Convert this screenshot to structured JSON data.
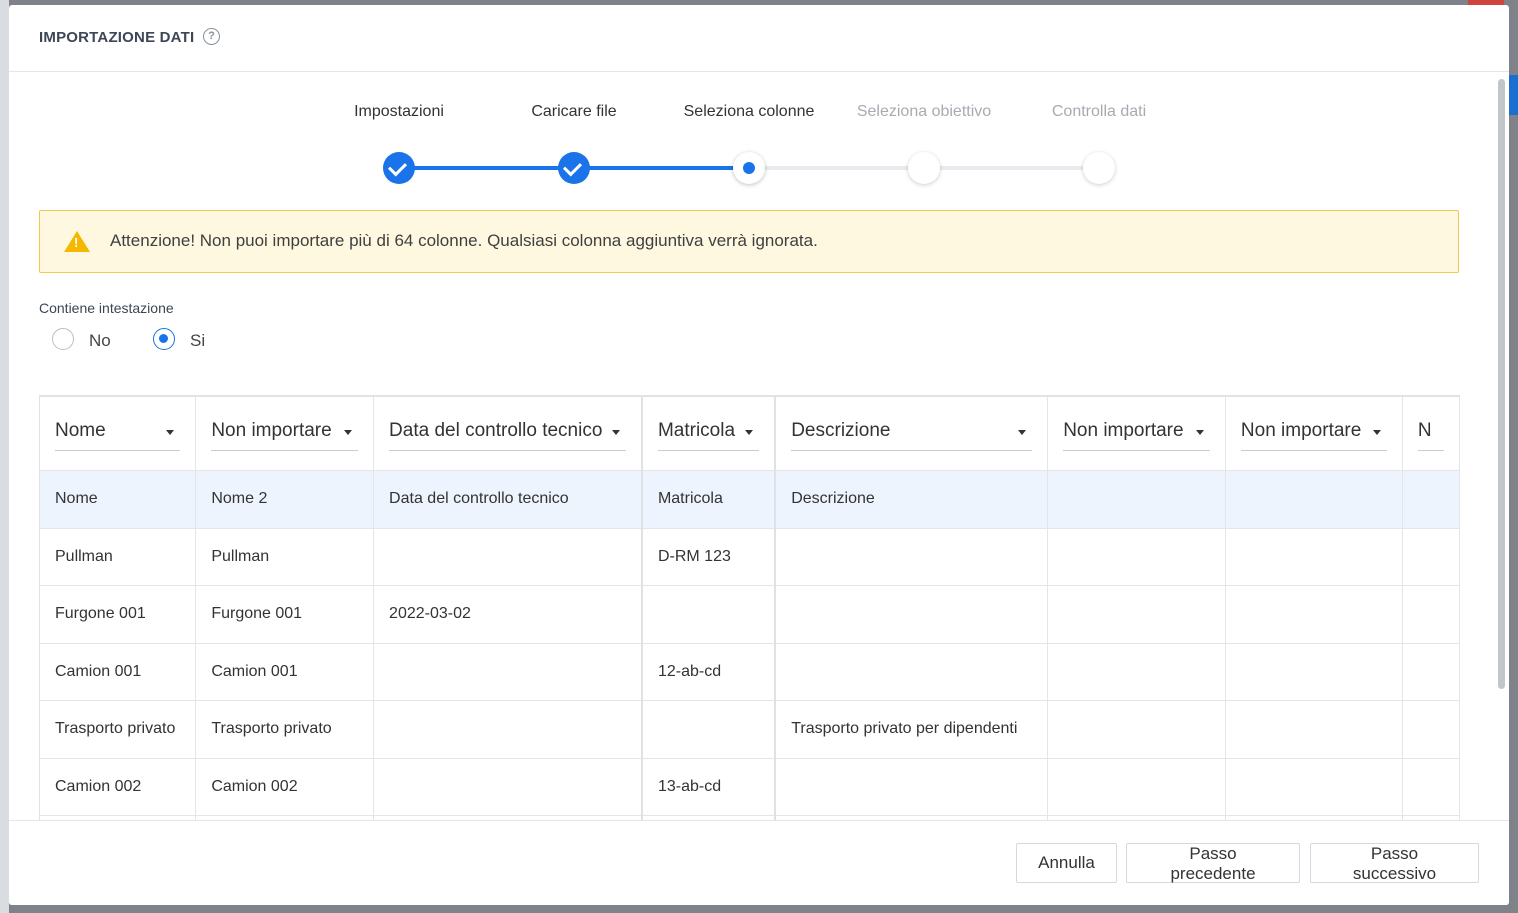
{
  "modal": {
    "title": "IMPORTAZIONE DATI",
    "help_icon": "?"
  },
  "stepper": {
    "steps": [
      {
        "label": "Impostazioni",
        "state": "done"
      },
      {
        "label": "Caricare file",
        "state": "done"
      },
      {
        "label": "Seleziona colonne",
        "state": "current"
      },
      {
        "label": "Seleziona obiettivo",
        "state": "todo"
      },
      {
        "label": "Controlla dati",
        "state": "todo"
      }
    ]
  },
  "warning": {
    "icon": "warning-triangle-icon",
    "icon_glyph": "!",
    "text": "Attenzione! Non puoi importare più di 64 colonne. Qualsiasi colonna aggiuntiva verrà ignorata."
  },
  "header_option": {
    "label": "Contiene intestazione",
    "options": [
      {
        "label": "No",
        "selected": false
      },
      {
        "label": "Si",
        "selected": true
      }
    ]
  },
  "table": {
    "column_selects": [
      "Nome",
      "Non importare",
      "Data del controllo tecnico",
      "Matricola",
      "Descrizione",
      "Non importare",
      "Non importare",
      "N"
    ],
    "rows": [
      [
        "Nome",
        "Nome 2",
        "Data del controllo tecnico",
        "Matricola",
        "Descrizione",
        "",
        "",
        ""
      ],
      [
        "Pullman",
        "Pullman",
        "",
        "D-RM 123",
        "",
        "",
        "",
        ""
      ],
      [
        "Furgone 001",
        "Furgone 001",
        "2022-03-02",
        "",
        "",
        "",
        "",
        ""
      ],
      [
        "Camion 001",
        "Camion 001",
        "",
        "12-ab-cd",
        "",
        "",
        "",
        ""
      ],
      [
        "Trasporto privato",
        "Trasporto privato",
        "",
        "",
        "Trasporto privato per dipendenti",
        "",
        "",
        ""
      ],
      [
        "Camion 002",
        "Camion 002",
        "",
        "13-ab-cd",
        "",
        "",
        "",
        ""
      ],
      [
        "",
        "",
        "",
        "",
        "",
        "",
        "",
        ""
      ]
    ]
  },
  "footer": {
    "cancel_label": "Annulla",
    "prev_label": "Passo precedente",
    "next_label": "Passo successivo"
  },
  "colors": {
    "accent": "#1a73e8",
    "warning_bg": "#fff8e1",
    "warning_border": "#f2c94c",
    "header_row_bg": "#eef4fd"
  }
}
